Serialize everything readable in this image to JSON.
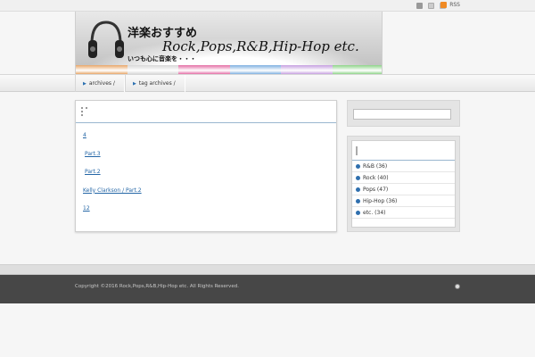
{
  "topbar": {
    "rss_label": "RSS",
    "icons": [
      "user-icon",
      "page-icon",
      "lock-icon",
      "rss-icon"
    ]
  },
  "header": {
    "jp_title": "洋楽おすすめ",
    "en_title": "Rock,Pops,R&B,Hip-Hop etc.",
    "tagline": "いつも心に音楽を・・・",
    "stripe_colors": [
      "#e8a76a",
      "#d8d8d8",
      "#e46fa6",
      "#7fb0e0",
      "#c6a0e0",
      "#8fd48a"
    ]
  },
  "nav": {
    "items": [
      {
        "label": "archives /"
      },
      {
        "label": "tag archives /"
      }
    ]
  },
  "main": {
    "links": [
      {
        "label": "4"
      },
      {
        "label": "Part.3"
      },
      {
        "label": "Part.2"
      },
      {
        "label": "Kelly Clarkson / Part.2"
      },
      {
        "label": "12"
      }
    ]
  },
  "sidebar": {
    "search": {
      "placeholder": ""
    },
    "categories": [
      {
        "label": "R&B (36)"
      },
      {
        "label": "Rock (40)"
      },
      {
        "label": "Pops (47)"
      },
      {
        "label": "Hip-Hop (36)"
      },
      {
        "label": "etc. (34)"
      }
    ]
  },
  "footer": {
    "copyright": "Copyright ©2016 Rock,Pops,R&B,Hip-Hop etc. All Rights Reserved."
  },
  "colors": {
    "link": "#2466a6",
    "footer_bg": "#474747",
    "accent_line": "#9ab6cf",
    "rss": "#f08a24"
  }
}
